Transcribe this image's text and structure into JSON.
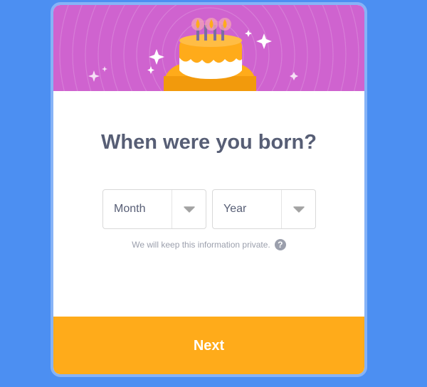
{
  "dialog": {
    "title": "When were you born?",
    "month_select": {
      "value": "Month"
    },
    "year_select": {
      "value": "Year"
    },
    "privacy_note": "We will keep this information private.",
    "help_icon_glyph": "?",
    "next_label": "Next"
  },
  "banner": {
    "image": "birthday-cake-illustration"
  },
  "colors": {
    "page_background": "#4c8ff2",
    "modal_border": "#86b3f7",
    "banner_background": "#cf63cf",
    "title_text": "#575e75",
    "muted_text": "#9b9fac",
    "next_button": "#ffab1a",
    "cake": "#ffab1a",
    "frosting": "#ffffff",
    "candles": "#7a6ea0"
  }
}
